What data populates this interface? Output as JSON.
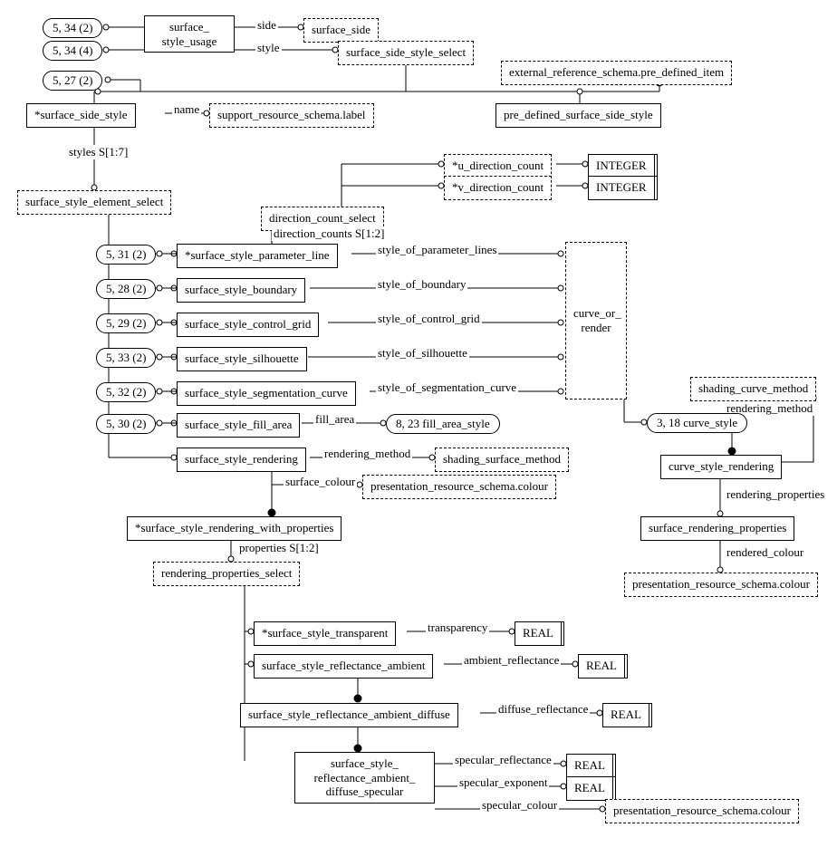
{
  "refs": {
    "r1": "5, 34 (2)",
    "r2": "5, 34 (4)",
    "r3": "5, 27 (2)",
    "r4": "5, 31 (2)",
    "r5": "5, 28 (2)",
    "r6": "5, 29 (2)",
    "r7": "5, 33 (2)",
    "r8": "5, 32 (2)",
    "r9": "5, 30 (2)",
    "r10": "8, 23 fill_area_style",
    "r11": "3, 18 curve_style"
  },
  "top": {
    "usage": "surface_\nstyle_usage",
    "side_lbl": "side",
    "side": "surface_side",
    "style_lbl": "style",
    "styleSel": "surface_side_style_select",
    "ext": "external_reference_schema.pre_defined_item",
    "predef": "pre_defined_surface_side_style",
    "sideStyle": "*surface_side_style",
    "name_lbl": "name",
    "label": "support_resource_schema.label",
    "styles_lbl": "styles S[1:7]",
    "elemSel": "surface_style_element_select"
  },
  "dc": {
    "u": "*u_direction_count",
    "v": "*v_direction_count",
    "int": "INTEGER",
    "sel": "direction_count_select",
    "cnt_lbl": "direction_counts S[1:2]"
  },
  "mid": {
    "param": "*surface_style_parameter_line",
    "param_lbl": "style_of_parameter_lines",
    "boundary": "surface_style_boundary",
    "boundary_lbl": "style_of_boundary",
    "cgrid": "surface_style_control_grid",
    "cgrid_lbl": "style_of_control_grid",
    "sil": "surface_style_silhouette",
    "sil_lbl": "style_of_silhouette",
    "seg": "surface_style_segmentation_curve",
    "seg_lbl": "style_of_segmentation_curve",
    "fill": "surface_style_fill_area",
    "fill_lbl": "fill_area",
    "render": "surface_style_rendering",
    "render_lbl": "rendering_method",
    "shade": "shading_surface_method",
    "colour_lbl": "surface_colour",
    "colour": "presentation_resource_schema.colour",
    "cor": "curve_or_\nrender"
  },
  "right": {
    "scm": "shading_curve_method",
    "rm_lbl": "rendering_method",
    "csr": "curve_style_rendering",
    "rp_lbl": "rendering_properties",
    "srp": "surface_rendering_properties",
    "rc_lbl": "rendered_colour",
    "colour": "presentation_resource_schema.colour"
  },
  "bot": {
    "rwp": "*surface_style_rendering_with_properties",
    "props_lbl": "properties S[1:2]",
    "rps": "rendering_properties_select",
    "transp": "*surface_style_transparent",
    "transp_lbl": "transparency",
    "real": "REAL",
    "amb": "surface_style_reflectance_ambient",
    "amb_lbl": "ambient_reflectance",
    "diff": "surface_style_reflectance_ambient_diffuse",
    "diff_lbl": "diffuse_reflectance",
    "spec": "surface_style_\nreflectance_ambient_\ndiffuse_specular",
    "sr_lbl": "specular_reflectance",
    "se_lbl": "specular_exponent",
    "sc_lbl": "specular_colour",
    "colour": "presentation_resource_schema.colour"
  }
}
